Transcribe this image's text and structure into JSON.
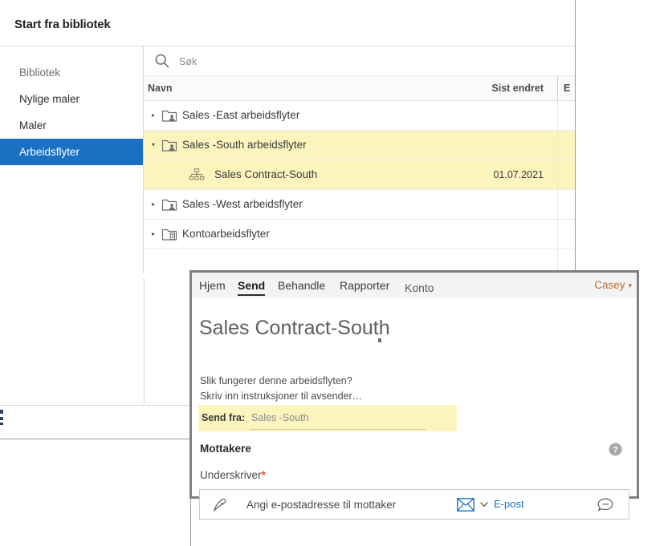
{
  "library_dialog": {
    "title": "Start fra bibliotek",
    "sidebar": {
      "items": [
        {
          "label": "Bibliotek",
          "selected": false,
          "muted": true
        },
        {
          "label": "Nylige maler",
          "selected": false,
          "muted": false
        },
        {
          "label": "Maler",
          "selected": false,
          "muted": false
        },
        {
          "label": "Arbeidsflyter",
          "selected": true,
          "muted": false
        }
      ]
    },
    "search": {
      "placeholder": "Søk",
      "value": "",
      "icon": "search-icon"
    },
    "table": {
      "columns": {
        "name": "Navn",
        "modified": "Sist endret",
        "extra": "E"
      },
      "rows": [
        {
          "label": "Sales -East arbeidsflyter",
          "icon": "folder-user-icon",
          "twisty": "▸",
          "expanded": false,
          "child": false,
          "highlight": false,
          "modified": ""
        },
        {
          "label": "Sales -South arbeidsflyter",
          "icon": "folder-user-icon",
          "twisty": "▾",
          "expanded": true,
          "child": false,
          "highlight": true,
          "modified": ""
        },
        {
          "label": "Sales Contract-South",
          "icon": "workflow-icon",
          "twisty": "",
          "expanded": false,
          "child": true,
          "highlight": true,
          "modified": "01.07.2021"
        },
        {
          "label": "Sales -West arbeidsflyter",
          "icon": "folder-user-icon",
          "twisty": "▸",
          "expanded": false,
          "child": false,
          "highlight": false,
          "modified": ""
        },
        {
          "label": "Kontoarbeidsflyter",
          "icon": "folder-doc-icon",
          "twisty": "▸",
          "expanded": false,
          "child": false,
          "highlight": false,
          "modified": ""
        }
      ]
    }
  },
  "send_window": {
    "tabs": [
      {
        "label": "Hjem",
        "active": false,
        "muted": false
      },
      {
        "label": "Send",
        "active": true,
        "muted": false
      },
      {
        "label": "Behandle",
        "active": false,
        "muted": false
      },
      {
        "label": "Rapporter",
        "active": false,
        "muted": false
      },
      {
        "label": "Konto",
        "active": false,
        "muted": true
      }
    ],
    "user_menu": {
      "label": "Casey",
      "caret": "▾"
    },
    "document_title": "Sales Contract-South",
    "instructions": {
      "line1": "Slik fungerer denne arbeidsflyten?",
      "line2": "Skriv inn instruksjoner til avsender…"
    },
    "send_from": {
      "label": "Send fra:",
      "value": "Sales -South"
    },
    "recipients": {
      "heading": "Mottakere",
      "help_icon": "help-circle-icon",
      "role_label": "Underskriver",
      "required_marker": "*",
      "field": {
        "pen_icon": "pen-icon",
        "placeholder": "Angi e-postadresse til mottaker",
        "value": "",
        "envelope_icon": "envelope-icon",
        "method_caret": "▾",
        "method_label": "E-post",
        "comment_icon": "comment-icon"
      }
    }
  },
  "colors": {
    "accent_blue": "#1a71c4",
    "link_blue": "#1473c7",
    "highlight_yellow": "#fbf5bd",
    "required_orange": "#e8541a",
    "user_menu_orange": "#b5743a",
    "window_border_gray": "#808080"
  }
}
